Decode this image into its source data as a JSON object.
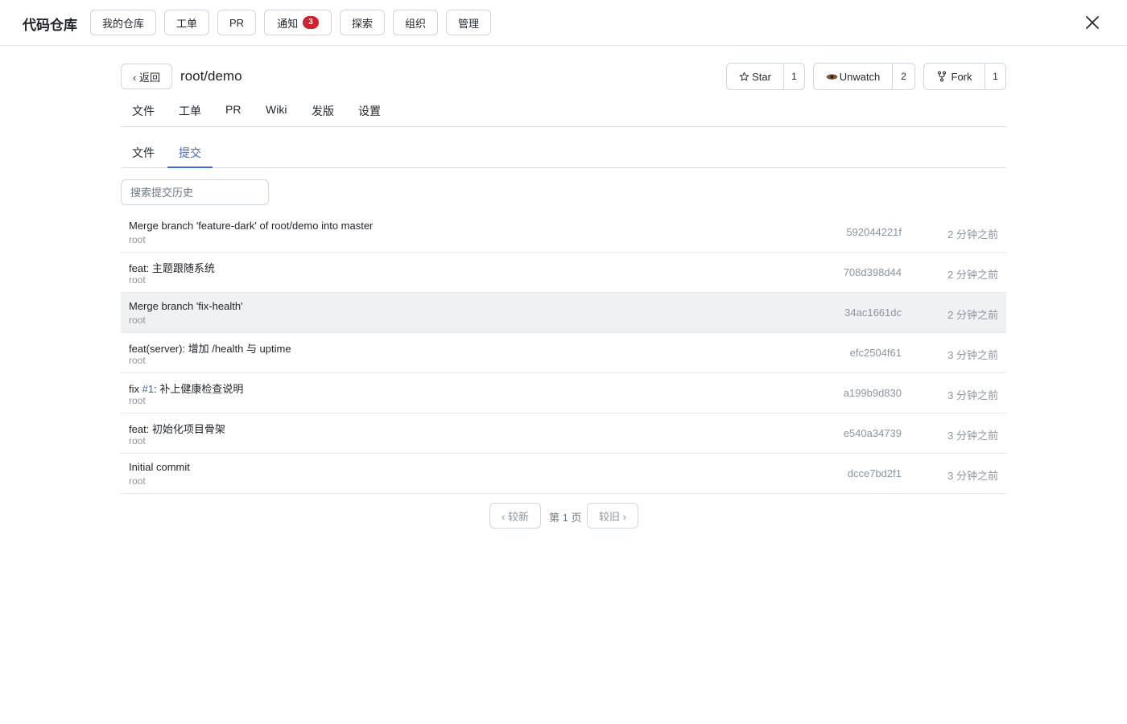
{
  "app": {
    "title": "代码仓库"
  },
  "top_nav": [
    {
      "label": "我的仓库"
    },
    {
      "label": "工单"
    },
    {
      "label": "PR"
    },
    {
      "label": "通知",
      "badge": "3"
    },
    {
      "label": "探索"
    },
    {
      "label": "组织"
    },
    {
      "label": "管理"
    }
  ],
  "repo": {
    "back_label": "‹ 返回",
    "name": "root/demo",
    "star": {
      "label": "Star",
      "count": "1"
    },
    "watch": {
      "label": "Unwatch",
      "count": "2"
    },
    "fork": {
      "label": "Fork",
      "count": "1"
    }
  },
  "repo_tabs": [
    {
      "label": "文件"
    },
    {
      "label": "工单"
    },
    {
      "label": "PR"
    },
    {
      "label": "Wiki"
    },
    {
      "label": "发版"
    },
    {
      "label": "设置"
    }
  ],
  "sub_tabs": [
    {
      "label": "文件",
      "active": false
    },
    {
      "label": "提交",
      "active": true
    }
  ],
  "search": {
    "placeholder": "搜索提交历史",
    "value": ""
  },
  "commits": [
    {
      "message": "Merge branch 'feature-dark' of root/demo into master",
      "author": "root",
      "sha": "592044221f",
      "time": "2 分钟之前"
    },
    {
      "message": "feat: 主题跟随系统",
      "author": "root",
      "sha": "708d398d44",
      "time": "2 分钟之前"
    },
    {
      "message": "Merge branch 'fix-health'",
      "author": "root",
      "sha": "34ac1661dc",
      "time": "2 分钟之前"
    },
    {
      "message": "feat(server): 增加 /health 与 uptime",
      "author": "root",
      "sha": "efc2504f61",
      "time": "3 分钟之前"
    },
    {
      "message_prefix": "fix ",
      "message_link": "#1",
      "message_suffix": ": 补上健康检查说明",
      "author": "root",
      "sha": "a199b9d830",
      "time": "3 分钟之前"
    },
    {
      "message": "feat: 初始化项目骨架",
      "author": "root",
      "sha": "e540a34739",
      "time": "3 分钟之前"
    },
    {
      "message": "Initial commit",
      "author": "root",
      "sha": "dcce7bd2f1",
      "time": "3 分钟之前"
    }
  ],
  "pagination": {
    "newer": "‹ 较新",
    "page": "第 1 页",
    "older": "较旧 ›"
  }
}
